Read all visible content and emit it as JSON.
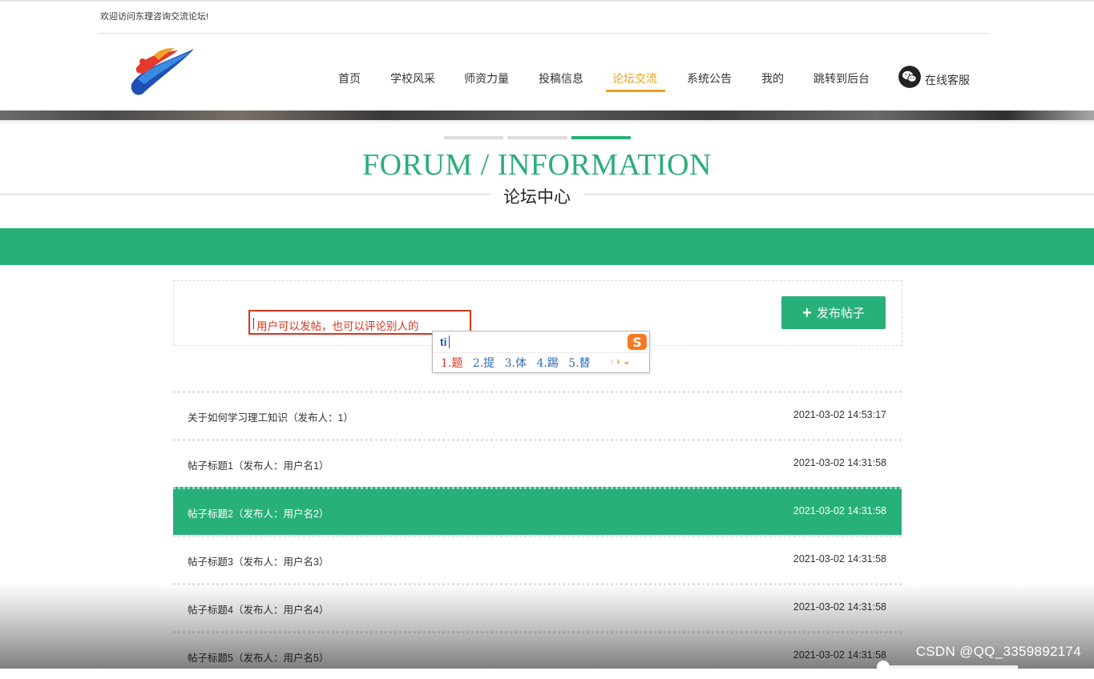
{
  "header": {
    "welcome": "欢迎访问东理咨询交流论坛!",
    "nav": [
      {
        "label": "首页",
        "active": false
      },
      {
        "label": "学校风采",
        "active": false
      },
      {
        "label": "师资力量",
        "active": false
      },
      {
        "label": "投稿信息",
        "active": false
      },
      {
        "label": "论坛交流",
        "active": true
      },
      {
        "label": "系统公告",
        "active": false
      },
      {
        "label": "我的",
        "active": false
      },
      {
        "label": "跳转到后台",
        "active": false
      }
    ],
    "service_label": "在线客服",
    "service_icon": "wechat-icon"
  },
  "section": {
    "title_en": "FORUM / INFORMATION",
    "title_cn": "论坛中心"
  },
  "compose": {
    "annotation": "用户可以发帖，也可以评论别人的",
    "post_button": "发布帖子",
    "post_icon": "plus-icon"
  },
  "ime": {
    "input": "ti",
    "candidates": [
      "1.题",
      "2.提",
      "3.体",
      "4.踢",
      "5.替"
    ]
  },
  "posts": [
    {
      "title": "关于如何学习理工知识（发布人：1）",
      "time": "2021-03-02 14:53:17",
      "active": false
    },
    {
      "title": "帖子标题1（发布人：用户名1）",
      "time": "2021-03-02 14:31:58",
      "active": false
    },
    {
      "title": "帖子标题2（发布人：用户名2）",
      "time": "2021-03-02 14:31:58",
      "active": true
    },
    {
      "title": "帖子标题3（发布人：用户名3）",
      "time": "2021-03-02 14:31:58",
      "active": false
    },
    {
      "title": "帖子标题4（发布人：用户名4）",
      "time": "2021-03-02 14:31:58",
      "active": false
    },
    {
      "title": "帖子标题5（发布人：用户名5）",
      "time": "2021-03-02 14:31:58",
      "active": false
    }
  ],
  "watermark": "CSDN @QQ_3359892174",
  "colors": {
    "accent": "#28b07a",
    "nav_active": "#e9a21b",
    "annotation": "#d9341f"
  }
}
